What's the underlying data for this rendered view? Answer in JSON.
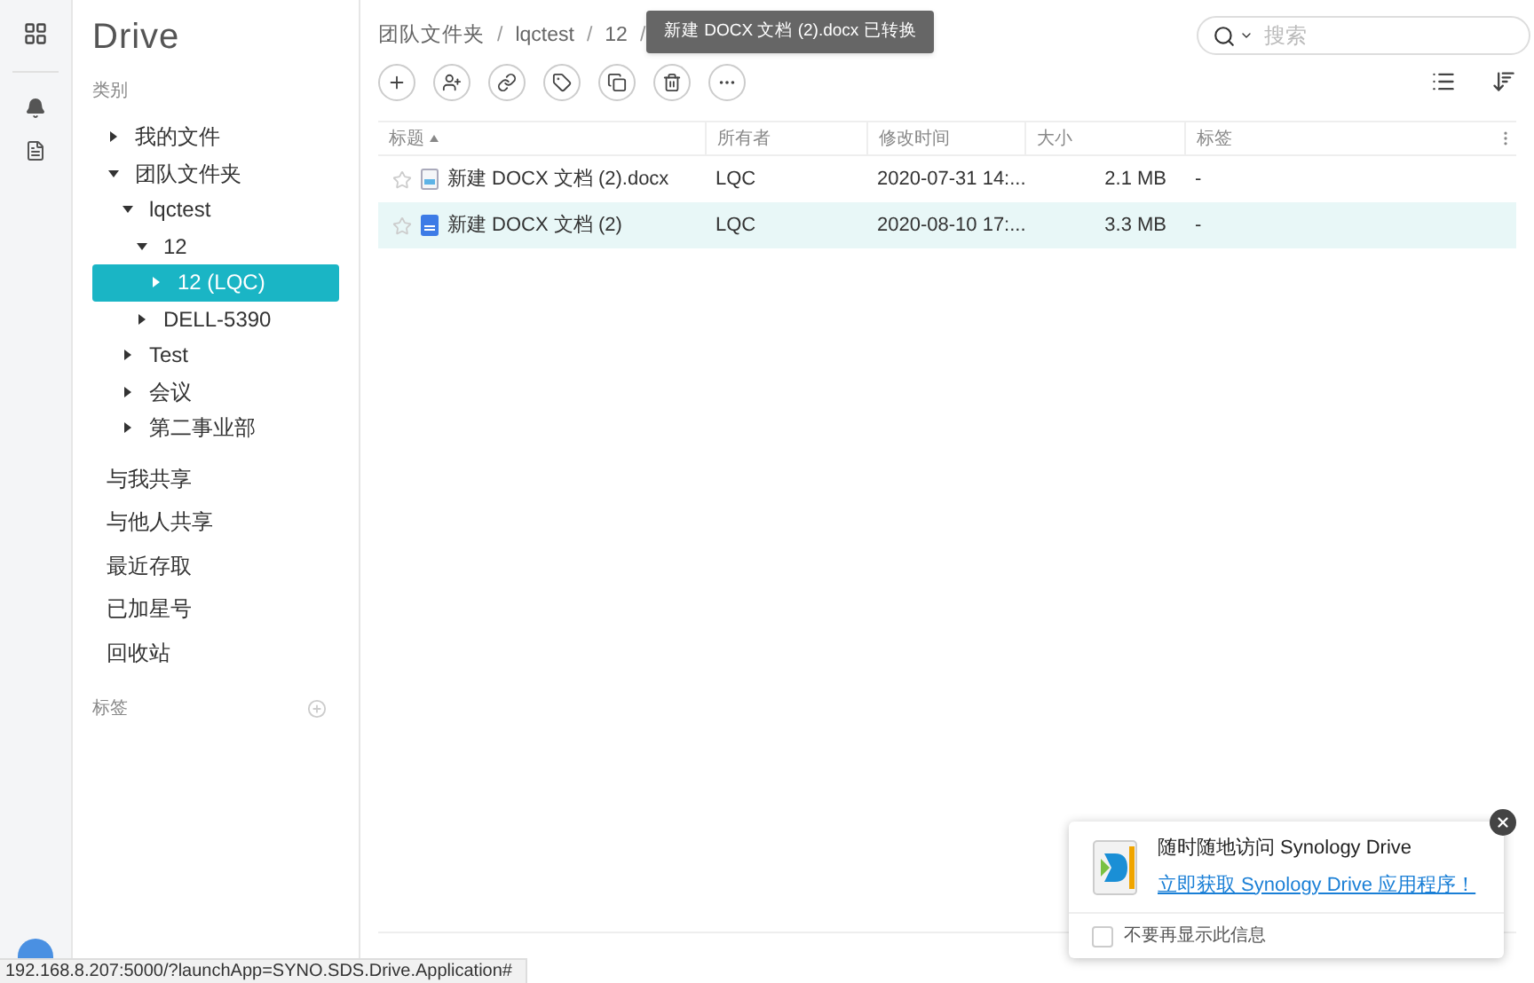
{
  "logo": "Drive",
  "sidebar": {
    "section_label": "类别",
    "tree": [
      {
        "label": "我的文件",
        "expanded": false,
        "selected": false
      },
      {
        "label": "团队文件夹",
        "expanded": true,
        "selected": false,
        "children": [
          {
            "label": "lqctest",
            "expanded": true,
            "selected": false,
            "children": [
              {
                "label": "12",
                "expanded": true,
                "selected": false,
                "children": [
                  {
                    "label": "12 (LQC)",
                    "expanded": false,
                    "selected": true
                  }
                ]
              },
              {
                "label": "DELL-5390",
                "expanded": false,
                "selected": false
              }
            ]
          },
          {
            "label": "Test",
            "expanded": false,
            "selected": false
          },
          {
            "label": "会议",
            "expanded": false,
            "selected": false
          },
          {
            "label": "第二事业部",
            "expanded": false,
            "selected": false
          }
        ]
      }
    ],
    "links": [
      "与我共享",
      "与他人共享",
      "最近存取",
      "已加星号",
      "回收站"
    ],
    "tags_label": "标签"
  },
  "breadcrumb": [
    {
      "kind": "folder",
      "text": "团队文件夹"
    },
    {
      "kind": "separator",
      "text": "/"
    },
    {
      "kind": "folder",
      "text": "lqctest"
    },
    {
      "kind": "separator",
      "text": "/"
    },
    {
      "kind": "folder",
      "text": "12"
    },
    {
      "kind": "separator",
      "text": "/"
    }
  ],
  "toast": "新建 DOCX 文档 (2).docx 已转换",
  "search": {
    "placeholder": "搜索"
  },
  "table": {
    "columns": [
      "标题",
      "所有者",
      "修改时间",
      "大小",
      "标签"
    ],
    "rows": [
      {
        "kind": "file",
        "name": "新建 DOCX 文档 (2).docx",
        "owner": "LQC",
        "modified": "2020-07-31 14:...",
        "size": "2.1 MB",
        "tags": "-",
        "selected": false,
        "starred": false
      },
      {
        "kind": "doc",
        "name": "新建 DOCX 文档 (2)",
        "owner": "LQC",
        "modified": "2020-08-10 17:...",
        "size": "3.3 MB",
        "tags": "-",
        "selected": true,
        "starred": false
      }
    ]
  },
  "promo": {
    "title": "随时随地访问 Synology Drive",
    "link": "立即获取 Synology Drive 应用程序！",
    "checkbox_label": "不要再显示此信息",
    "checked": false
  },
  "status_bar": "192.168.8.207:5000/?launchApp=SYNO.SDS.Drive.Application#"
}
